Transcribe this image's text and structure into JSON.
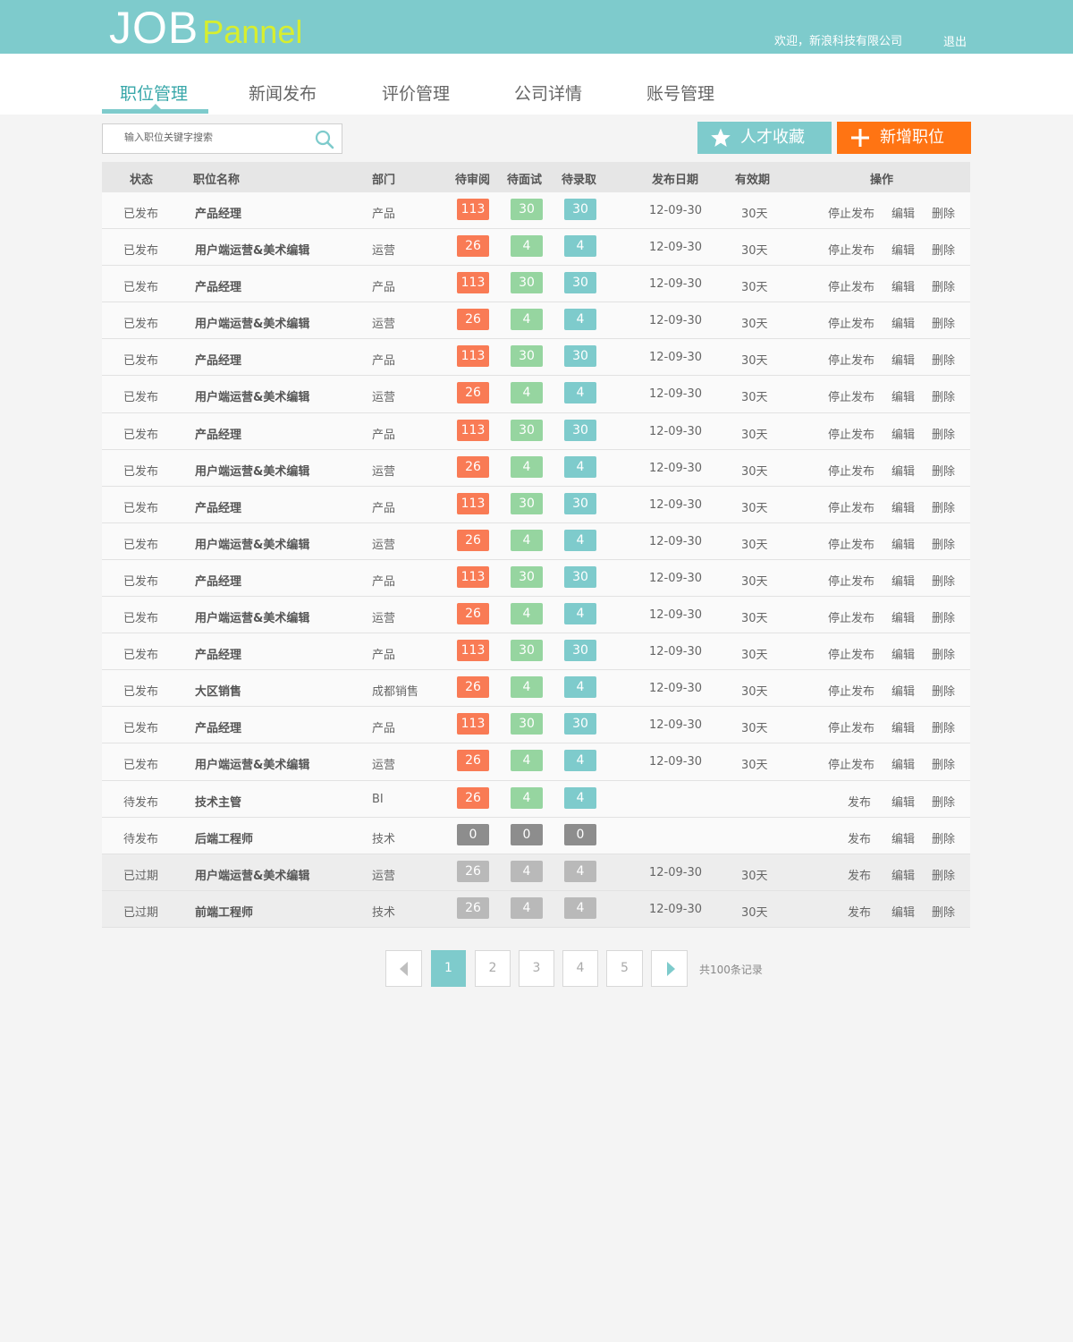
{
  "header": {
    "logo_job": "JOB",
    "logo_pannel": "Pannel",
    "welcome": "欢迎，新浪科技有限公司",
    "logout": "退出"
  },
  "nav": {
    "tabs": [
      {
        "label": "职位管理",
        "active": true
      },
      {
        "label": "新闻发布",
        "active": false
      },
      {
        "label": "评价管理",
        "active": false
      },
      {
        "label": "公司详情",
        "active": false
      },
      {
        "label": "账号管理",
        "active": false
      }
    ]
  },
  "toolbar": {
    "search_placeholder": "输入职位关键字搜索",
    "search_icon": "search-icon",
    "fav_label": "人才收藏",
    "fav_icon": "star-icon",
    "add_label": "新增职位",
    "add_icon": "plus-icon"
  },
  "table": {
    "headers": {
      "status": "状态",
      "name": "职位名称",
      "dept": "部门",
      "review": "待审阅",
      "interview": "待面试",
      "hire": "待录取",
      "date": "发布日期",
      "valid": "有效期",
      "ops": "操作"
    },
    "rows": [
      {
        "status": "已发布",
        "name": "产品经理",
        "dept": "产品",
        "review": "113",
        "interview": "30",
        "hire": "30",
        "date": "12-09-30",
        "valid": "30天",
        "ops": [
          "停止发布",
          "编辑",
          "删除"
        ],
        "state": "published"
      },
      {
        "status": "已发布",
        "name": "用户端运营&美术编辑",
        "dept": "运营",
        "review": "26",
        "interview": "4",
        "hire": "4",
        "date": "12-09-30",
        "valid": "30天",
        "ops": [
          "停止发布",
          "编辑",
          "删除"
        ],
        "state": "published"
      },
      {
        "status": "已发布",
        "name": "产品经理",
        "dept": "产品",
        "review": "113",
        "interview": "30",
        "hire": "30",
        "date": "12-09-30",
        "valid": "30天",
        "ops": [
          "停止发布",
          "编辑",
          "删除"
        ],
        "state": "published"
      },
      {
        "status": "已发布",
        "name": "用户端运营&美术编辑",
        "dept": "运营",
        "review": "26",
        "interview": "4",
        "hire": "4",
        "date": "12-09-30",
        "valid": "30天",
        "ops": [
          "停止发布",
          "编辑",
          "删除"
        ],
        "state": "published"
      },
      {
        "status": "已发布",
        "name": "产品经理",
        "dept": "产品",
        "review": "113",
        "interview": "30",
        "hire": "30",
        "date": "12-09-30",
        "valid": "30天",
        "ops": [
          "停止发布",
          "编辑",
          "删除"
        ],
        "state": "published"
      },
      {
        "status": "已发布",
        "name": "用户端运营&美术编辑",
        "dept": "运营",
        "review": "26",
        "interview": "4",
        "hire": "4",
        "date": "12-09-30",
        "valid": "30天",
        "ops": [
          "停止发布",
          "编辑",
          "删除"
        ],
        "state": "published"
      },
      {
        "status": "已发布",
        "name": "产品经理",
        "dept": "产品",
        "review": "113",
        "interview": "30",
        "hire": "30",
        "date": "12-09-30",
        "valid": "30天",
        "ops": [
          "停止发布",
          "编辑",
          "删除"
        ],
        "state": "published"
      },
      {
        "status": "已发布",
        "name": "用户端运营&美术编辑",
        "dept": "运营",
        "review": "26",
        "interview": "4",
        "hire": "4",
        "date": "12-09-30",
        "valid": "30天",
        "ops": [
          "停止发布",
          "编辑",
          "删除"
        ],
        "state": "published"
      },
      {
        "status": "已发布",
        "name": "产品经理",
        "dept": "产品",
        "review": "113",
        "interview": "30",
        "hire": "30",
        "date": "12-09-30",
        "valid": "30天",
        "ops": [
          "停止发布",
          "编辑",
          "删除"
        ],
        "state": "published"
      },
      {
        "status": "已发布",
        "name": "用户端运营&美术编辑",
        "dept": "运营",
        "review": "26",
        "interview": "4",
        "hire": "4",
        "date": "12-09-30",
        "valid": "30天",
        "ops": [
          "停止发布",
          "编辑",
          "删除"
        ],
        "state": "published"
      },
      {
        "status": "已发布",
        "name": "产品经理",
        "dept": "产品",
        "review": "113",
        "interview": "30",
        "hire": "30",
        "date": "12-09-30",
        "valid": "30天",
        "ops": [
          "停止发布",
          "编辑",
          "删除"
        ],
        "state": "published"
      },
      {
        "status": "已发布",
        "name": "用户端运营&美术编辑",
        "dept": "运营",
        "review": "26",
        "interview": "4",
        "hire": "4",
        "date": "12-09-30",
        "valid": "30天",
        "ops": [
          "停止发布",
          "编辑",
          "删除"
        ],
        "state": "published"
      },
      {
        "status": "已发布",
        "name": "产品经理",
        "dept": "产品",
        "review": "113",
        "interview": "30",
        "hire": "30",
        "date": "12-09-30",
        "valid": "30天",
        "ops": [
          "停止发布",
          "编辑",
          "删除"
        ],
        "state": "published"
      },
      {
        "status": "已发布",
        "name": "大区销售",
        "dept": "成都销售",
        "review": "26",
        "interview": "4",
        "hire": "4",
        "date": "12-09-30",
        "valid": "30天",
        "ops": [
          "停止发布",
          "编辑",
          "删除"
        ],
        "state": "published"
      },
      {
        "status": "已发布",
        "name": "产品经理",
        "dept": "产品",
        "review": "113",
        "interview": "30",
        "hire": "30",
        "date": "12-09-30",
        "valid": "30天",
        "ops": [
          "停止发布",
          "编辑",
          "删除"
        ],
        "state": "published"
      },
      {
        "status": "已发布",
        "name": "用户端运营&美术编辑",
        "dept": "运营",
        "review": "26",
        "interview": "4",
        "hire": "4",
        "date": "12-09-30",
        "valid": "30天",
        "ops": [
          "停止发布",
          "编辑",
          "删除"
        ],
        "state": "published"
      },
      {
        "status": "待发布",
        "name": "技术主管",
        "dept": "BI",
        "review": "26",
        "interview": "4",
        "hire": "4",
        "date": "",
        "valid": "",
        "ops": [
          "发布",
          "编辑",
          "删除"
        ],
        "state": "pending"
      },
      {
        "status": "待发布",
        "name": "后端工程师",
        "dept": "技术",
        "review": "0",
        "interview": "0",
        "hire": "0",
        "date": "",
        "valid": "",
        "ops": [
          "发布",
          "编辑",
          "删除"
        ],
        "state": "zero"
      },
      {
        "status": "已过期",
        "name": "用户端运营&美术编辑",
        "dept": "运营",
        "review": "26",
        "interview": "4",
        "hire": "4",
        "date": "12-09-30",
        "valid": "30天",
        "ops": [
          "发布",
          "编辑",
          "删除"
        ],
        "state": "expired"
      },
      {
        "status": "已过期",
        "name": "前端工程师",
        "dept": "技术",
        "review": "26",
        "interview": "4",
        "hire": "4",
        "date": "12-09-30",
        "valid": "30天",
        "ops": [
          "发布",
          "编辑",
          "删除"
        ],
        "state": "expired"
      }
    ]
  },
  "colors": {
    "accent": "#7ecbcc",
    "orange": "#ff7413",
    "review": "#f97b55",
    "interview": "#96d5a0",
    "hire": "#7ecbcc",
    "zero": "#8d8d8d",
    "expired_badge": "#b9b9b9"
  },
  "pagination": {
    "prev_icon": "chevron-left-icon",
    "next_icon": "chevron-right-icon",
    "pages": [
      "1",
      "2",
      "3",
      "4",
      "5"
    ],
    "current": "1",
    "total": "共100条记录"
  }
}
